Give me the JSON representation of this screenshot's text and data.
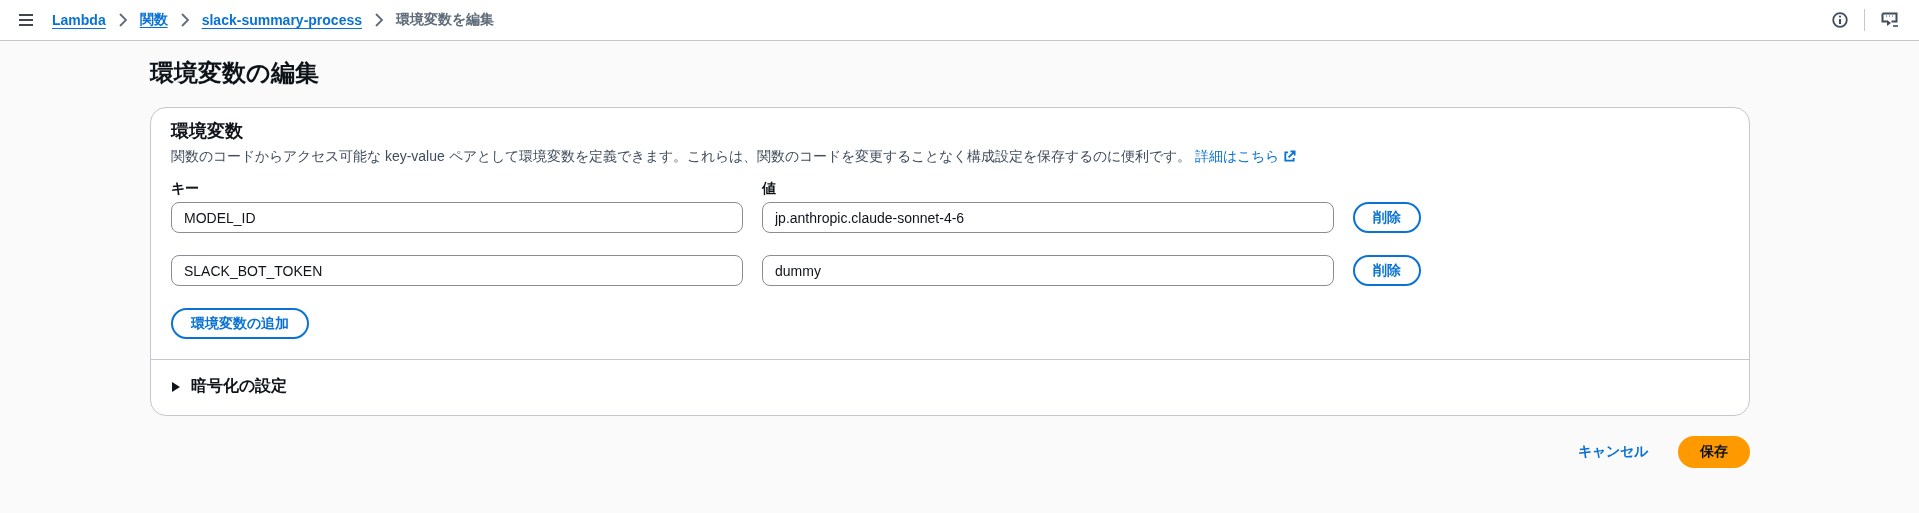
{
  "breadcrumbs": [
    {
      "label": "Lambda",
      "link": true
    },
    {
      "label": "関数",
      "link": true
    },
    {
      "label": "slack-summary-process",
      "link": true
    },
    {
      "label": "環境変数を編集",
      "link": false
    }
  ],
  "page_title": "環境変数の編集",
  "panel": {
    "title": "環境変数",
    "description": "関数のコードからアクセス可能な key-value ペアとして環境変数を定義できます。これらは、関数のコードを変更することなく構成設定を保存するのに便利です。",
    "learn_more": "詳細はこちら",
    "key_label": "キー",
    "value_label": "値",
    "variables": [
      {
        "key": "MODEL_ID",
        "value": "jp.anthropic.claude-sonnet-4-6",
        "remove": "削除"
      },
      {
        "key": "SLACK_BOT_TOKEN",
        "value": "dummy",
        "remove": "削除"
      }
    ],
    "add_button": "環境変数の追加",
    "encryption": {
      "label": "暗号化の設定",
      "expanded": false
    }
  },
  "actions": {
    "cancel": "キャンセル",
    "save": "保存"
  }
}
